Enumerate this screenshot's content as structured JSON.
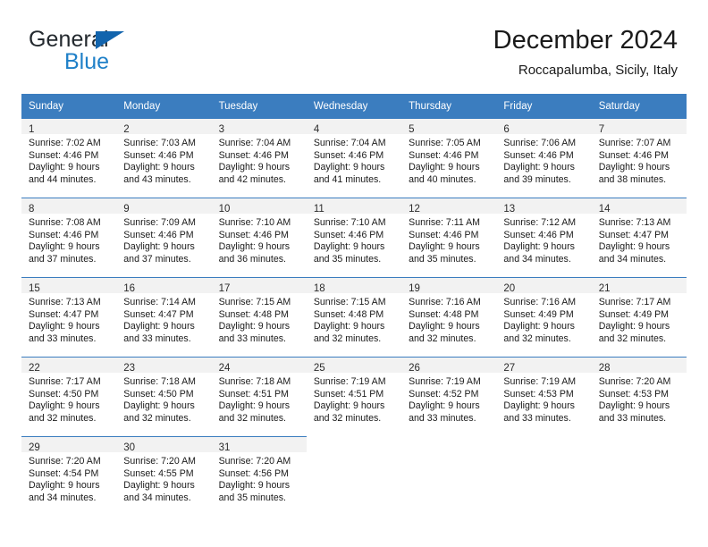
{
  "brand": {
    "name_top": "General",
    "name_bottom": "Blue",
    "triangle_color": "#1264ad",
    "top_color": "#23292e",
    "bottom_color": "#1f80c8"
  },
  "header": {
    "title": "December 2024",
    "subtitle": "Roccapalumba, Sicily, Italy"
  },
  "colors": {
    "header_bar": "#3b7dbf",
    "daynum_band": "#f2f2f2",
    "text": "#1a1a1a"
  },
  "weekdays": [
    "Sunday",
    "Monday",
    "Tuesday",
    "Wednesday",
    "Thursday",
    "Friday",
    "Saturday"
  ],
  "weeks": [
    [
      {
        "day": "1",
        "sunrise": "Sunrise: 7:02 AM",
        "sunset": "Sunset: 4:46 PM",
        "daylight1": "Daylight: 9 hours",
        "daylight2": "and 44 minutes."
      },
      {
        "day": "2",
        "sunrise": "Sunrise: 7:03 AM",
        "sunset": "Sunset: 4:46 PM",
        "daylight1": "Daylight: 9 hours",
        "daylight2": "and 43 minutes."
      },
      {
        "day": "3",
        "sunrise": "Sunrise: 7:04 AM",
        "sunset": "Sunset: 4:46 PM",
        "daylight1": "Daylight: 9 hours",
        "daylight2": "and 42 minutes."
      },
      {
        "day": "4",
        "sunrise": "Sunrise: 7:04 AM",
        "sunset": "Sunset: 4:46 PM",
        "daylight1": "Daylight: 9 hours",
        "daylight2": "and 41 minutes."
      },
      {
        "day": "5",
        "sunrise": "Sunrise: 7:05 AM",
        "sunset": "Sunset: 4:46 PM",
        "daylight1": "Daylight: 9 hours",
        "daylight2": "and 40 minutes."
      },
      {
        "day": "6",
        "sunrise": "Sunrise: 7:06 AM",
        "sunset": "Sunset: 4:46 PM",
        "daylight1": "Daylight: 9 hours",
        "daylight2": "and 39 minutes."
      },
      {
        "day": "7",
        "sunrise": "Sunrise: 7:07 AM",
        "sunset": "Sunset: 4:46 PM",
        "daylight1": "Daylight: 9 hours",
        "daylight2": "and 38 minutes."
      }
    ],
    [
      {
        "day": "8",
        "sunrise": "Sunrise: 7:08 AM",
        "sunset": "Sunset: 4:46 PM",
        "daylight1": "Daylight: 9 hours",
        "daylight2": "and 37 minutes."
      },
      {
        "day": "9",
        "sunrise": "Sunrise: 7:09 AM",
        "sunset": "Sunset: 4:46 PM",
        "daylight1": "Daylight: 9 hours",
        "daylight2": "and 37 minutes."
      },
      {
        "day": "10",
        "sunrise": "Sunrise: 7:10 AM",
        "sunset": "Sunset: 4:46 PM",
        "daylight1": "Daylight: 9 hours",
        "daylight2": "and 36 minutes."
      },
      {
        "day": "11",
        "sunrise": "Sunrise: 7:10 AM",
        "sunset": "Sunset: 4:46 PM",
        "daylight1": "Daylight: 9 hours",
        "daylight2": "and 35 minutes."
      },
      {
        "day": "12",
        "sunrise": "Sunrise: 7:11 AM",
        "sunset": "Sunset: 4:46 PM",
        "daylight1": "Daylight: 9 hours",
        "daylight2": "and 35 minutes."
      },
      {
        "day": "13",
        "sunrise": "Sunrise: 7:12 AM",
        "sunset": "Sunset: 4:46 PM",
        "daylight1": "Daylight: 9 hours",
        "daylight2": "and 34 minutes."
      },
      {
        "day": "14",
        "sunrise": "Sunrise: 7:13 AM",
        "sunset": "Sunset: 4:47 PM",
        "daylight1": "Daylight: 9 hours",
        "daylight2": "and 34 minutes."
      }
    ],
    [
      {
        "day": "15",
        "sunrise": "Sunrise: 7:13 AM",
        "sunset": "Sunset: 4:47 PM",
        "daylight1": "Daylight: 9 hours",
        "daylight2": "and 33 minutes."
      },
      {
        "day": "16",
        "sunrise": "Sunrise: 7:14 AM",
        "sunset": "Sunset: 4:47 PM",
        "daylight1": "Daylight: 9 hours",
        "daylight2": "and 33 minutes."
      },
      {
        "day": "17",
        "sunrise": "Sunrise: 7:15 AM",
        "sunset": "Sunset: 4:48 PM",
        "daylight1": "Daylight: 9 hours",
        "daylight2": "and 33 minutes."
      },
      {
        "day": "18",
        "sunrise": "Sunrise: 7:15 AM",
        "sunset": "Sunset: 4:48 PM",
        "daylight1": "Daylight: 9 hours",
        "daylight2": "and 32 minutes."
      },
      {
        "day": "19",
        "sunrise": "Sunrise: 7:16 AM",
        "sunset": "Sunset: 4:48 PM",
        "daylight1": "Daylight: 9 hours",
        "daylight2": "and 32 minutes."
      },
      {
        "day": "20",
        "sunrise": "Sunrise: 7:16 AM",
        "sunset": "Sunset: 4:49 PM",
        "daylight1": "Daylight: 9 hours",
        "daylight2": "and 32 minutes."
      },
      {
        "day": "21",
        "sunrise": "Sunrise: 7:17 AM",
        "sunset": "Sunset: 4:49 PM",
        "daylight1": "Daylight: 9 hours",
        "daylight2": "and 32 minutes."
      }
    ],
    [
      {
        "day": "22",
        "sunrise": "Sunrise: 7:17 AM",
        "sunset": "Sunset: 4:50 PM",
        "daylight1": "Daylight: 9 hours",
        "daylight2": "and 32 minutes."
      },
      {
        "day": "23",
        "sunrise": "Sunrise: 7:18 AM",
        "sunset": "Sunset: 4:50 PM",
        "daylight1": "Daylight: 9 hours",
        "daylight2": "and 32 minutes."
      },
      {
        "day": "24",
        "sunrise": "Sunrise: 7:18 AM",
        "sunset": "Sunset: 4:51 PM",
        "daylight1": "Daylight: 9 hours",
        "daylight2": "and 32 minutes."
      },
      {
        "day": "25",
        "sunrise": "Sunrise: 7:19 AM",
        "sunset": "Sunset: 4:51 PM",
        "daylight1": "Daylight: 9 hours",
        "daylight2": "and 32 minutes."
      },
      {
        "day": "26",
        "sunrise": "Sunrise: 7:19 AM",
        "sunset": "Sunset: 4:52 PM",
        "daylight1": "Daylight: 9 hours",
        "daylight2": "and 33 minutes."
      },
      {
        "day": "27",
        "sunrise": "Sunrise: 7:19 AM",
        "sunset": "Sunset: 4:53 PM",
        "daylight1": "Daylight: 9 hours",
        "daylight2": "and 33 minutes."
      },
      {
        "day": "28",
        "sunrise": "Sunrise: 7:20 AM",
        "sunset": "Sunset: 4:53 PM",
        "daylight1": "Daylight: 9 hours",
        "daylight2": "and 33 minutes."
      }
    ],
    [
      {
        "day": "29",
        "sunrise": "Sunrise: 7:20 AM",
        "sunset": "Sunset: 4:54 PM",
        "daylight1": "Daylight: 9 hours",
        "daylight2": "and 34 minutes."
      },
      {
        "day": "30",
        "sunrise": "Sunrise: 7:20 AM",
        "sunset": "Sunset: 4:55 PM",
        "daylight1": "Daylight: 9 hours",
        "daylight2": "and 34 minutes."
      },
      {
        "day": "31",
        "sunrise": "Sunrise: 7:20 AM",
        "sunset": "Sunset: 4:56 PM",
        "daylight1": "Daylight: 9 hours",
        "daylight2": "and 35 minutes."
      },
      {
        "day": "",
        "sunrise": "",
        "sunset": "",
        "daylight1": "",
        "daylight2": ""
      },
      {
        "day": "",
        "sunrise": "",
        "sunset": "",
        "daylight1": "",
        "daylight2": ""
      },
      {
        "day": "",
        "sunrise": "",
        "sunset": "",
        "daylight1": "",
        "daylight2": ""
      },
      {
        "day": "",
        "sunrise": "",
        "sunset": "",
        "daylight1": "",
        "daylight2": ""
      }
    ]
  ]
}
